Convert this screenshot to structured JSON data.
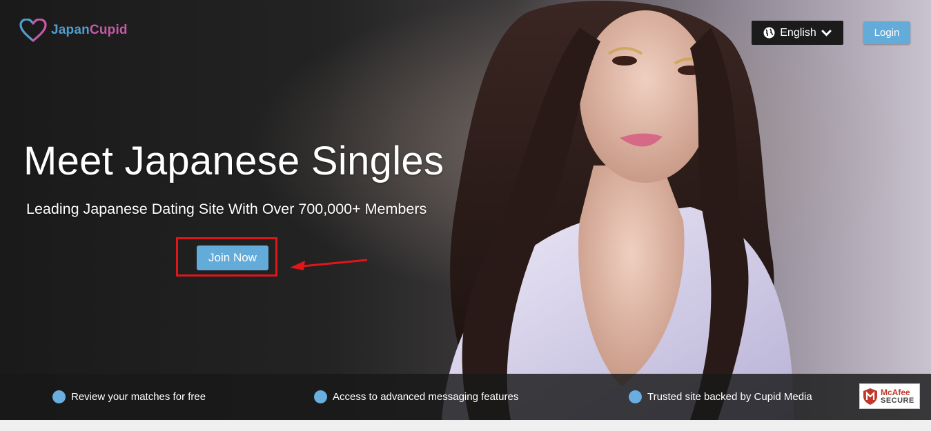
{
  "brand": {
    "name_part1": "Japan",
    "name_part2": "Cupid",
    "logo_icon": "heart-logo-icon"
  },
  "header": {
    "language_label": "English",
    "language_icon": "globe-icon",
    "dropdown_icon": "chevron-down-icon",
    "login_label": "Login"
  },
  "hero": {
    "headline": "Meet Japanese Singles",
    "subline": "Leading Japanese Dating Site With Over 700,000+ Members",
    "join_label": "Join Now"
  },
  "features": [
    {
      "label": "Review your matches for free"
    },
    {
      "label": "Access to advanced messaging features"
    },
    {
      "label": "Trusted site backed by Cupid Media"
    }
  ],
  "badge": {
    "line1": "McAfee",
    "line2": "SECURE"
  },
  "colors": {
    "accent": "#63abd8",
    "highlight": "#e0161b",
    "logo_blue": "#4f9fd1",
    "logo_pink": "#c65aa8"
  }
}
